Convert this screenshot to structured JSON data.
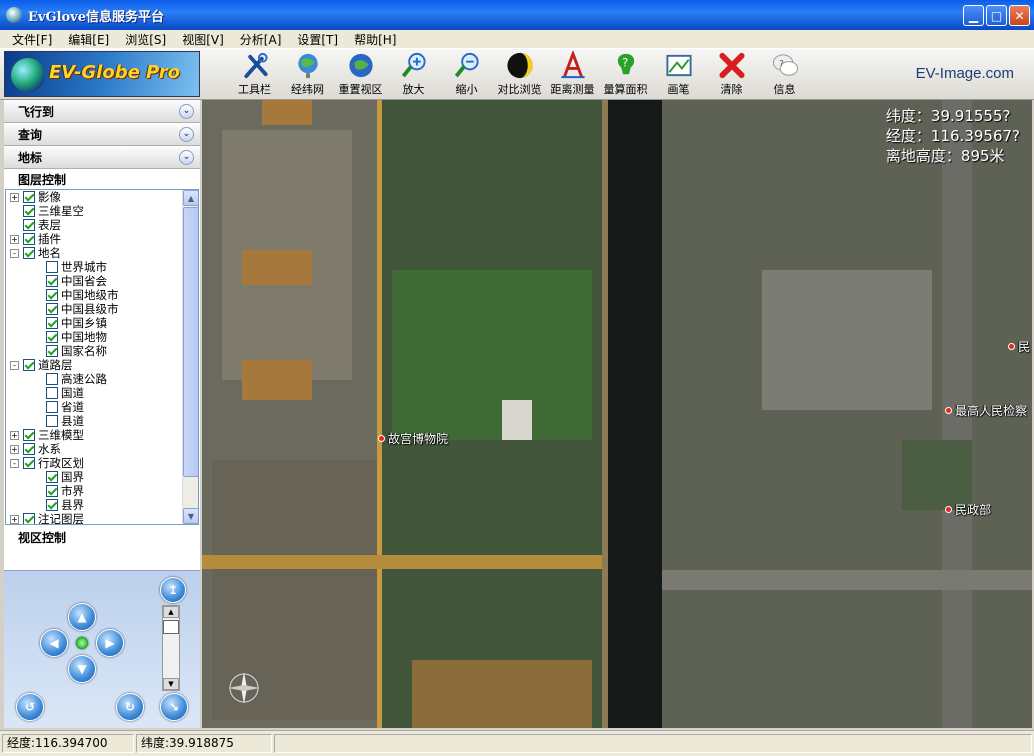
{
  "window": {
    "title": "EvGlove信息服务平台"
  },
  "menu": [
    "文件[F]",
    "编辑[E]",
    "浏览[S]",
    "视图[V]",
    "分析[A]",
    "设置[T]",
    "帮助[H]"
  ],
  "logo": {
    "text": "EV-Globe Pro"
  },
  "toolbar": {
    "tools": [
      {
        "label": "工具栏",
        "icon": "tools-icon"
      },
      {
        "label": "经纬网",
        "icon": "globe-grid-icon"
      },
      {
        "label": "重置视区",
        "icon": "reset-view-icon"
      },
      {
        "label": "放大",
        "icon": "zoom-in-icon"
      },
      {
        "label": "缩小",
        "icon": "zoom-out-icon"
      },
      {
        "label": "对比浏览",
        "icon": "compare-icon"
      },
      {
        "label": "距离测量",
        "icon": "measure-distance-icon"
      },
      {
        "label": "量算面积",
        "icon": "measure-area-icon"
      },
      {
        "label": "画笔",
        "icon": "pen-icon"
      },
      {
        "label": "清除",
        "icon": "clear-icon"
      },
      {
        "label": "信息",
        "icon": "info-icon"
      }
    ],
    "brand": "EV-Image.com"
  },
  "sidebar": {
    "sections": [
      "飞行到",
      "查询",
      "地标"
    ],
    "layer_title": "图层控制",
    "view_title": "视区控制"
  },
  "layers": [
    {
      "label": "影像",
      "level": 0,
      "exp": "+",
      "checked": true
    },
    {
      "label": "三维星空",
      "level": 0,
      "exp": "",
      "checked": true
    },
    {
      "label": "表层",
      "level": 0,
      "exp": "",
      "checked": true
    },
    {
      "label": "插件",
      "level": 0,
      "exp": "+",
      "checked": true
    },
    {
      "label": "地名",
      "level": 0,
      "exp": "-",
      "checked": true
    },
    {
      "label": "世界城市",
      "level": 1,
      "exp": "",
      "checked": false
    },
    {
      "label": "中国省会",
      "level": 1,
      "exp": "",
      "checked": true
    },
    {
      "label": "中国地级市",
      "level": 1,
      "exp": "",
      "checked": true
    },
    {
      "label": "中国县级市",
      "level": 1,
      "exp": "",
      "checked": true
    },
    {
      "label": "中国乡镇",
      "level": 1,
      "exp": "",
      "checked": true
    },
    {
      "label": "中国地物",
      "level": 1,
      "exp": "",
      "checked": true
    },
    {
      "label": "国家名称",
      "level": 1,
      "exp": "",
      "checked": true
    },
    {
      "label": "道路层",
      "level": 0,
      "exp": "-",
      "checked": true
    },
    {
      "label": "高速公路",
      "level": 1,
      "exp": "",
      "checked": false
    },
    {
      "label": "国道",
      "level": 1,
      "exp": "",
      "checked": false
    },
    {
      "label": "省道",
      "level": 1,
      "exp": "",
      "checked": false
    },
    {
      "label": "县道",
      "level": 1,
      "exp": "",
      "checked": false
    },
    {
      "label": "三维模型",
      "level": 0,
      "exp": "+",
      "checked": true
    },
    {
      "label": "水系",
      "level": 0,
      "exp": "+",
      "checked": true
    },
    {
      "label": "行政区划",
      "level": 0,
      "exp": "-",
      "checked": true
    },
    {
      "label": "国界",
      "level": 1,
      "exp": "",
      "checked": true
    },
    {
      "label": "市界",
      "level": 1,
      "exp": "",
      "checked": true
    },
    {
      "label": "县界",
      "level": 1,
      "exp": "",
      "checked": true
    },
    {
      "label": "注记图层",
      "level": 0,
      "exp": "+",
      "checked": true
    }
  ],
  "map": {
    "readout": {
      "lat": "纬度：39.91555?",
      "lon": "经度：116.39567?",
      "alt": "离地高度：895米"
    },
    "pois": [
      "故宫博物院",
      "最高人民检察",
      "民政部",
      "民"
    ]
  },
  "status": {
    "lon": "经度:116.394700",
    "lat": "纬度:39.918875"
  }
}
